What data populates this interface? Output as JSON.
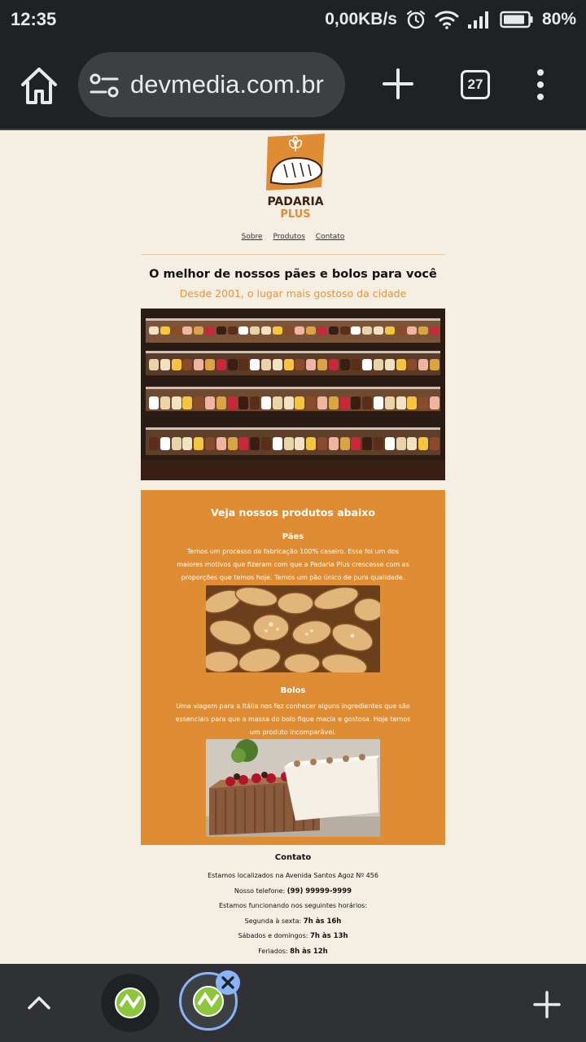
{
  "status_bar": {
    "time": "12:35",
    "net_speed": "0,00KB/s",
    "battery": "80%"
  },
  "browser": {
    "url": "devmedia.com.br",
    "tab_count": "27"
  },
  "site": {
    "logo_line1": "PADARIA",
    "logo_line2": "PLUS",
    "nav": [
      "Sobre",
      "Produtos",
      "Contato"
    ],
    "hero_title": "O melhor de nossos pães e bolos para você",
    "hero_subtitle": "Desde 2001, o lugar mais gostoso da cidade",
    "products": {
      "heading": "Veja nossos produtos abaixo",
      "paes_title": "Pães",
      "paes_text": "Temos um processo de fabricação 100% caseiro. Esse foi um dos maiores motivos que fizeram com que a Padaria Plus crescesse com as proporções que temos hoje. Temos um pão único de pura qualidade.",
      "bolos_title": "Bolos",
      "bolos_text": "Uma viagem para a Itália nos fez conhecer alguns ingredientes que são essenciais para que a massa do bolo fique macia e gostosa. Hoje temos um produto incomparável."
    },
    "contact": {
      "title": "Contato",
      "address": "Estamos localizados na Avenida Santos Agoz Nº 456",
      "phone_label": "Nosso telefone:",
      "phone": "(99) 99999-9999",
      "hours_intro": "Estamos funcionando nos seguintes horários:",
      "weekdays_label": "Segunda à sexta:",
      "weekdays_hours": "7h às 16h",
      "weekend_label": "Sábados e domingos:",
      "weekend_hours": "7h às 13h",
      "holidays_label": "Feriados:",
      "holidays_hours": "8h às 12h"
    }
  },
  "colors": {
    "accent": "#df8d34",
    "page_bg": "#f4eee3",
    "chrome_dark": "#202124"
  }
}
